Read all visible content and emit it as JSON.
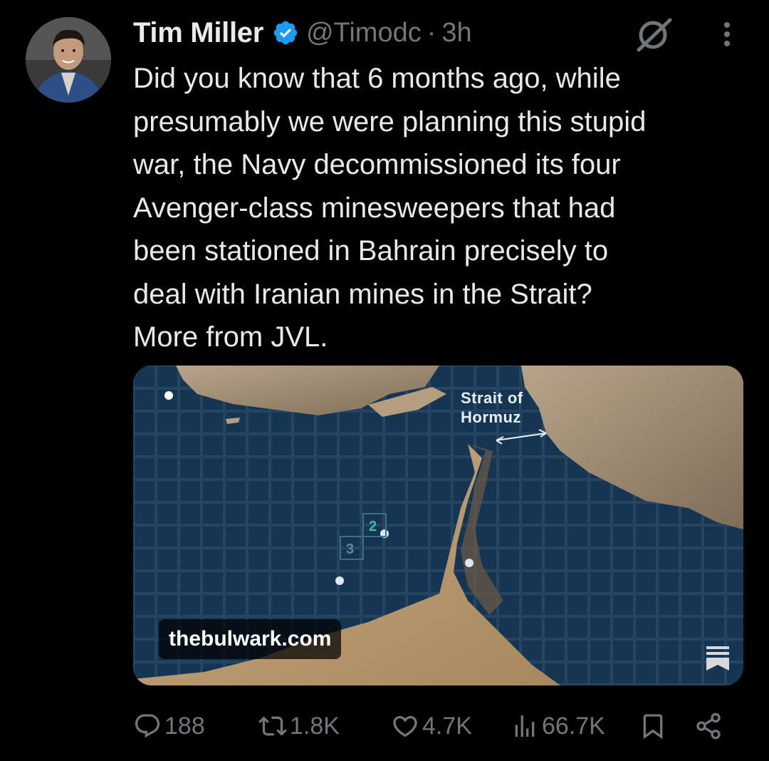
{
  "tweet": {
    "author": {
      "name": "Tim Miller",
      "handle": "@Timodc",
      "separator": "·",
      "time": "3h",
      "avatar_icon": "avatar-photo",
      "verified_icon": "verified-badge-icon"
    },
    "text": "Did you know that 6 months ago, while\npresumably we were planning this stupid\nwar, the Navy decommissioned its four\nAvenger-class minesweepers that had\nbeen stationed in Bahrain precisely to\ndeal with Iranian mines in the Strait?\nMore from JVL.",
    "header_icons": [
      "grok-icon",
      "more-options-icon"
    ]
  },
  "card": {
    "domain": "thebulwark.com",
    "map_label": "Strait of\nHormuz",
    "grid_markers": [
      "2",
      "3"
    ],
    "corner_icon": "article-icon"
  },
  "actions": {
    "reply_count": "188",
    "retweet_count": "1.8K",
    "like_count": "4.7K",
    "view_count": "66.7K",
    "icons": [
      "reply-icon",
      "retweet-icon",
      "like-icon",
      "views-icon",
      "bookmark-icon",
      "share-icon"
    ]
  },
  "colors": {
    "background": "#000000",
    "text_primary": "#e7e9ea",
    "text_secondary": "#71767b",
    "verified_blue": "#1d9bf0"
  }
}
